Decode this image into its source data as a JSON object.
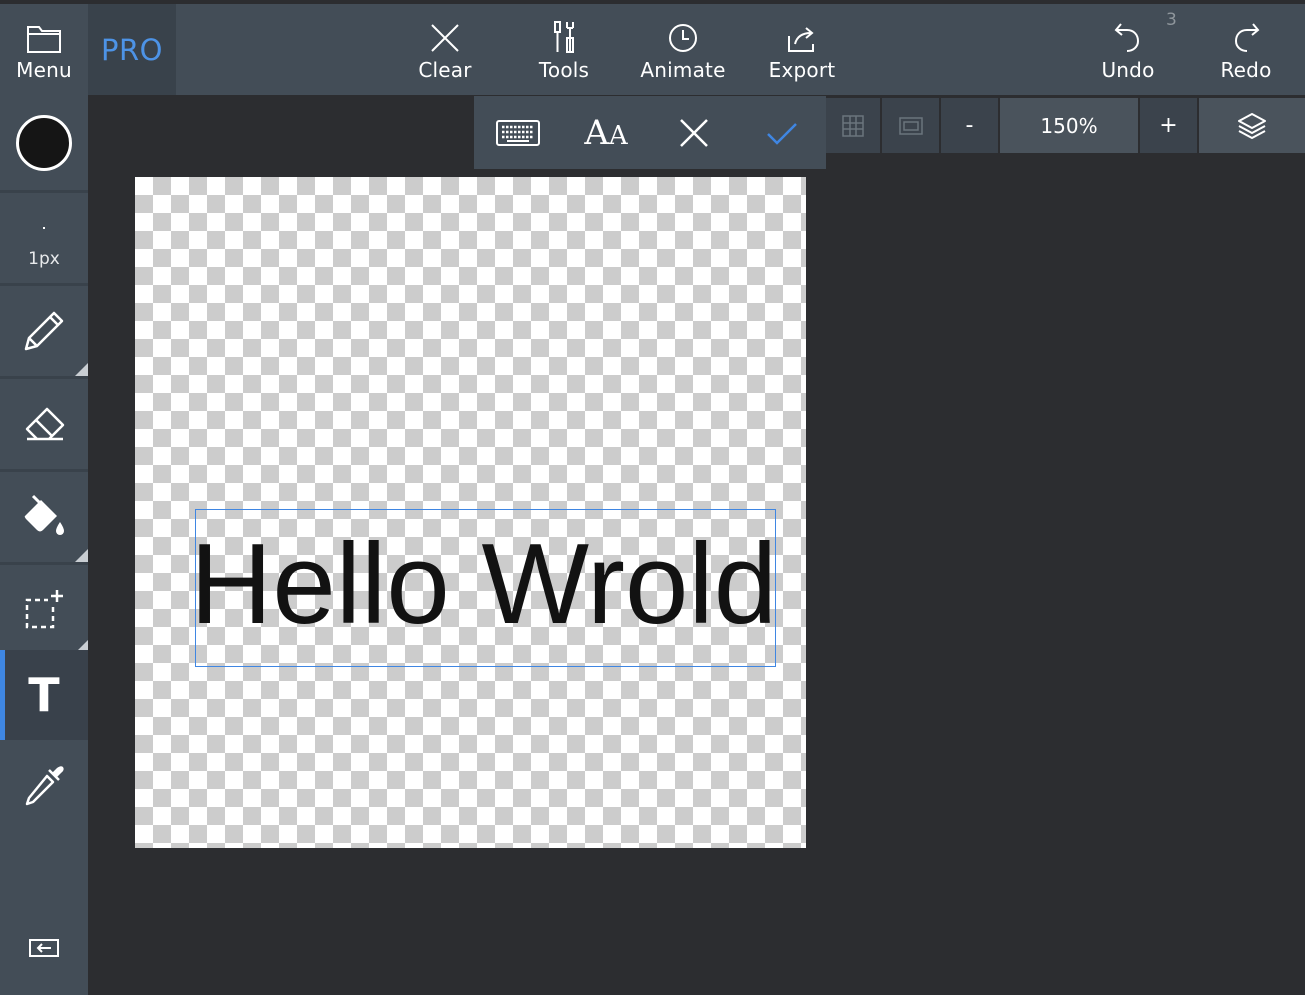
{
  "topbar": {
    "menu_label": "Menu",
    "pro_label": "PRO",
    "clear_label": "Clear",
    "tools_label": "Tools",
    "animate_label": "Animate",
    "export_label": "Export",
    "undo_label": "Undo",
    "undo_count": "3",
    "redo_label": "Redo"
  },
  "sidebar": {
    "color": "#151515",
    "brush_size": "1px",
    "tools": [
      "pencil-icon",
      "eraser-icon",
      "paint-bucket-icon",
      "selection-icon",
      "text-icon",
      "eyedropper-icon"
    ],
    "selected_tool": "text",
    "text_tool_glyph": "T",
    "collapse_icon": "collapse-panel-icon"
  },
  "view": {
    "zoom_out": "-",
    "zoom_value": "150%",
    "zoom_in": "+"
  },
  "text_toolbar": {
    "icons": [
      "keyboard-icon",
      "font-size-icon",
      "cancel-icon",
      "confirm-icon"
    ]
  },
  "canvas": {
    "text": "Hello Wrold",
    "text_color": "#121212",
    "selection_color": "#3f86e2"
  },
  "colors": {
    "accent": "#3f86e2",
    "toolbar_bg": "#434d57",
    "workspace_bg": "#2c2d30"
  }
}
